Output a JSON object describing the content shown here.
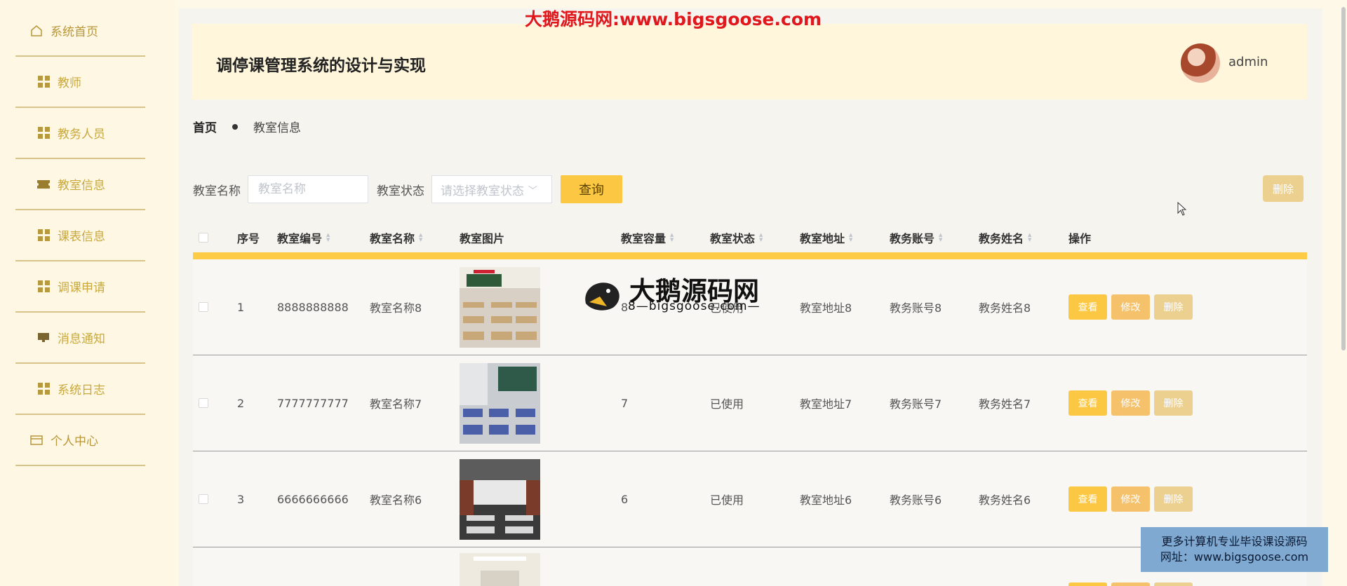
{
  "watermark_top": "大鹅源码网:www.bigsgoose.com",
  "sidebar": {
    "items": [
      {
        "label": "系统首页",
        "icon": "home-icon"
      },
      {
        "label": "教师",
        "icon": "grid-icon"
      },
      {
        "label": "教务人员",
        "icon": "grid-icon"
      },
      {
        "label": "教室信息",
        "icon": "ticket-icon"
      },
      {
        "label": "课表信息",
        "icon": "grid-icon"
      },
      {
        "label": "调课申请",
        "icon": "grid-icon"
      },
      {
        "label": "消息通知",
        "icon": "monitor-icon"
      },
      {
        "label": "系统日志",
        "icon": "grid-icon"
      },
      {
        "label": "个人中心",
        "icon": "card-icon"
      }
    ]
  },
  "header": {
    "title": "调停课管理系统的设计与实现",
    "user": "admin"
  },
  "breadcrumb": {
    "home": "首页",
    "current": "教室信息"
  },
  "filter": {
    "name_label": "教室名称",
    "name_placeholder": "教室名称",
    "status_label": "教室状态",
    "status_placeholder": "请选择教室状态",
    "query_button": "查询",
    "delete_button": "删除"
  },
  "table": {
    "headers": {
      "index": "序号",
      "code": "教室编号",
      "name": "教室名称",
      "image": "教室图片",
      "capacity": "教室容量",
      "status": "教室状态",
      "address": "教室地址",
      "account": "教务账号",
      "staff_name": "教务姓名",
      "ops": "操作"
    },
    "rows": [
      {
        "index": "1",
        "code": "8888888888",
        "name": "教室名称8",
        "capacity": "8",
        "status": "已使用",
        "address": "教室地址8",
        "account": "教务账号8",
        "staff_name": "教务姓名8"
      },
      {
        "index": "2",
        "code": "7777777777",
        "name": "教室名称7",
        "capacity": "7",
        "status": "已使用",
        "address": "教室地址7",
        "account": "教务账号7",
        "staff_name": "教务姓名7"
      },
      {
        "index": "3",
        "code": "6666666666",
        "name": "教室名称6",
        "capacity": "6",
        "status": "已使用",
        "address": "教室地址6",
        "account": "教务账号6",
        "staff_name": "教务姓名6"
      }
    ],
    "ops": {
      "view": "查看",
      "edit": "修改",
      "delete": "删除"
    }
  },
  "logo_watermark": {
    "big": "大鹅源码网",
    "small": "—bigsgoose.com—",
    "small_prefix": "8"
  },
  "promo": {
    "line1": "更多计算机专业毕设课设源码",
    "line2": "网址：www.bigsgoose.com"
  }
}
